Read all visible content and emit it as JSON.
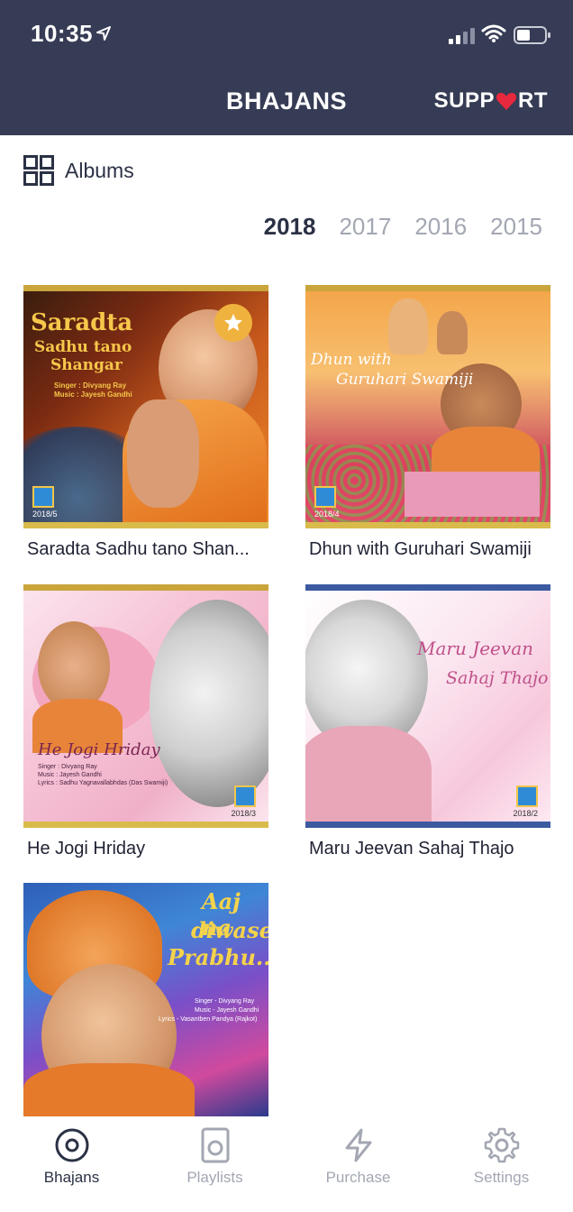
{
  "status_bar": {
    "time": "10:35"
  },
  "header": {
    "title": "BHAJANS",
    "support_label_left": "SUPP",
    "support_label_right": "RT"
  },
  "section": {
    "label": "Albums"
  },
  "years": [
    "2018",
    "2017",
    "2016",
    "2015"
  ],
  "active_year": "2018",
  "albums": [
    {
      "caption": "Saradta Sadhu tano Shan...",
      "cover_title_1": "Saradta",
      "cover_title_2": "Sadhu tano",
      "cover_title_3": "Shangar",
      "cover_credit_1": "Singer : Divyang Ray",
      "cover_credit_2": "Music : Jayesh Gandhi",
      "tag": "2018/5",
      "favorite": true
    },
    {
      "caption": "Dhun with Guruhari Swamiji",
      "cover_title_1": "Dhun with",
      "cover_title_2": "Guruhari Swamiji",
      "tag": "2018/4"
    },
    {
      "caption": "He Jogi Hriday",
      "cover_title_1": "He Jogi Hriday",
      "cover_credit_1": "Singer : Divyang Ray",
      "cover_credit_2": "Music : Jayesh Gandhi",
      "cover_credit_3": "Lyrics : Sadhu Yagnavallabhdas (Das Swamiji)",
      "tag": "2018/3"
    },
    {
      "caption": "Maru Jeevan Sahaj Thajo",
      "cover_title_1": "Maru Jeevan",
      "cover_title_2": "Sahaj Thajo",
      "tag": "2018/2"
    },
    {
      "caption": "",
      "cover_title_1": "Aaj na",
      "cover_title_2": "diwase",
      "cover_title_3": "Prabhu...",
      "cover_credit_1": "Singer - Divyang Ray",
      "cover_credit_2": "Music - Jayesh Gandhi",
      "cover_credit_3": "Lyrics - Vasantben Pandya (Rajkot)"
    }
  ],
  "tabs": [
    {
      "label": "Bhajans",
      "icon": "disc-icon",
      "active": true
    },
    {
      "label": "Playlists",
      "icon": "speaker-icon",
      "active": false
    },
    {
      "label": "Purchase",
      "icon": "lightning-icon",
      "active": false
    },
    {
      "label": "Settings",
      "icon": "gear-icon",
      "active": false
    }
  ],
  "colors": {
    "header_bg": "#363c55",
    "heart": "#e8283d",
    "active_text": "#2b3145",
    "inactive_text": "#a3a7b2",
    "gold_border": "#caa53b"
  }
}
